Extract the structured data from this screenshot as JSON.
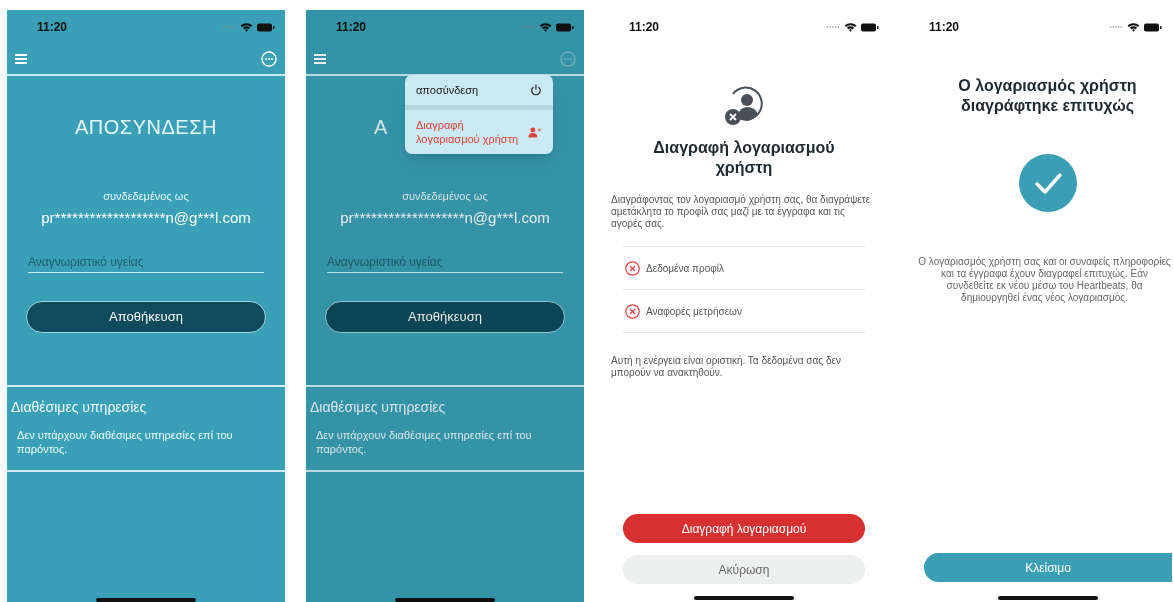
{
  "screens": [
    {
      "kind": "account",
      "time": "11:20",
      "title": "ΑΠΟΣΥΝΔΕΣΗ",
      "logged_in_label": "συνδεδεμένος ως",
      "email": "pr*******************n@g***l.com",
      "health_id_field": {
        "placeholder": "Αναγνωριστικό υγείας"
      },
      "save_button": "Αποθήκευση",
      "services_title": "Διαθέσιμες υπηρεσίες",
      "services_text": "Δεν υπάρχουν διαθέσιμες υπηρεσίες επί του παρόντος."
    },
    {
      "kind": "account",
      "time": "11:20",
      "title": "Α",
      "logged_in_label": "συνδεδεμένος ως",
      "email": "pr*******************n@g***l.com",
      "health_id_field": {
        "placeholder": "Αναγνωριστικό υγείας"
      },
      "save_button": "Αποθήκευση",
      "services_title": "Διαθέσιμες υπηρεσίες",
      "services_text": "Δεν υπάρχουν διαθέσιμες υπηρεσίες επί του παρόντος.",
      "menu": [
        {
          "kind": "logout",
          "label": "αποσύνδεση"
        },
        {
          "kind": "delete",
          "label": "Διαγραφή λογαριασμού χρήστη"
        }
      ]
    },
    {
      "kind": "delete_confirm",
      "time": "11:20",
      "title": "Διαγραφή λογαριασμού χρήστη",
      "description": "Διαγράφοντας τον λογαριασμό χρήστη σας, θα διαγράψετε αμετάκλητα το προφίλ σας μαζί με τα έγγραφα και τις αγορές σας.",
      "items": [
        "Δεδομένα προφίλ",
        "Αναφορές μετρήσεων"
      ],
      "warning": "Αυτή η ενέργεια είναι οριστική. Τα δεδομένα σας δεν μπορούν να ανακτηθούν.",
      "delete_button": "Διαγραφή λογαριασμού",
      "cancel_button": "Ακύρωση"
    },
    {
      "kind": "deleted",
      "time": "11:20",
      "title": "Ο λογαριασμός χρήστη διαγράφτηκε επιτυχώς",
      "message": "Ο λογαριασμός χρήστη σας και οι συναφείς πληροφορίες και τα έγγραφα έχουν διαγραφεί επιτυχώς. Εάν συνδεθείτε εκ νέου μέσω του Heartbeats, θα δημιουργηθεί ένας νέος λογαριασμός.",
      "close_button": "Κλείσιμο"
    }
  ]
}
